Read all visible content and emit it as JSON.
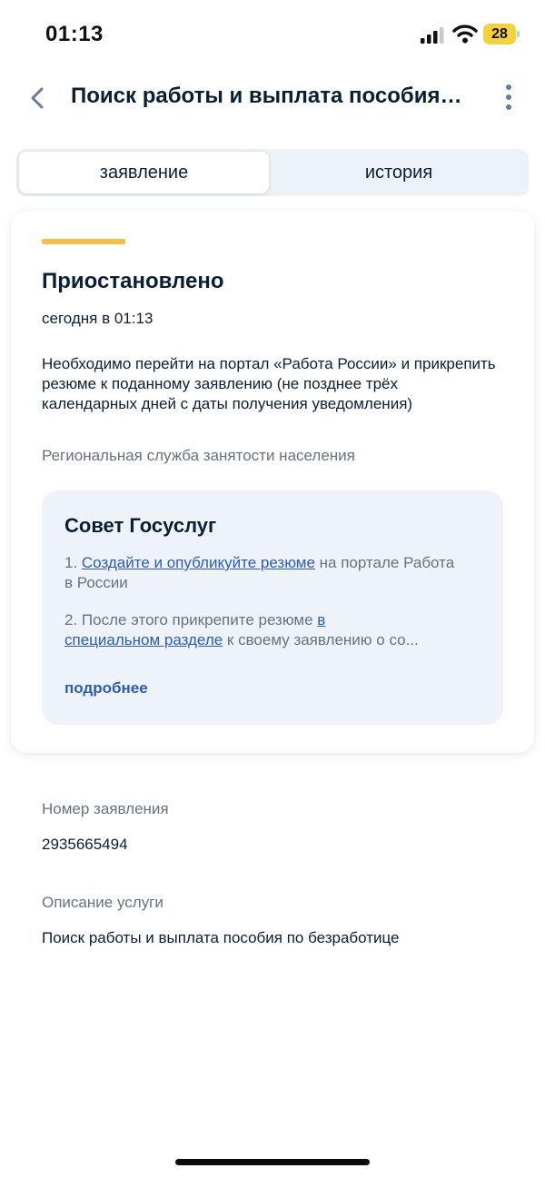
{
  "status_bar": {
    "time": "01:13",
    "battery": "28",
    "icons": [
      "signal-icon",
      "wifi-icon",
      "battery-icon"
    ]
  },
  "header": {
    "back_icon": "chevron-left-icon",
    "title": "Поиск работы и выплата пособия по безработице",
    "menu_icon": "more-vertical-icon"
  },
  "tabs": [
    {
      "label": "заявление",
      "active": true
    },
    {
      "label": "история",
      "active": false
    }
  ],
  "status_card": {
    "status": "Приостановлено",
    "status_color": "#efc04a",
    "date": "сегодня в 01:13",
    "message": "Необходимо перейти на портал «Работа России» и прикрепить резюме к поданному заявлению (не позднее трёх календарных дней с даты получения уведомления)",
    "organization": "Региональная служба занятости населения",
    "advice": {
      "title": "Совет Госуслуг",
      "item1_prefix": "1. ",
      "item1_link": "Создайте и опубликуйте резюме",
      "item1_suffix": " на портале Работа в России",
      "item2_prefix": "2. После этого прикрепите резюме ",
      "item2_link": "в специальном разделе",
      "item2_suffix": " к своему заявлению о со...",
      "more": "подробнее"
    }
  },
  "details": {
    "number_label": "Номер заявления",
    "number_value": "2935665494",
    "description_label": "Описание услуги",
    "description_value": "Поиск работы и выплата пособия по безработице"
  },
  "colors": {
    "accent_link": "#2e5bb6",
    "text_primary": "#0b1f33",
    "text_secondary": "#66727f",
    "tabs_bg": "#edf2f8",
    "advice_bg": "#eef3f9"
  }
}
